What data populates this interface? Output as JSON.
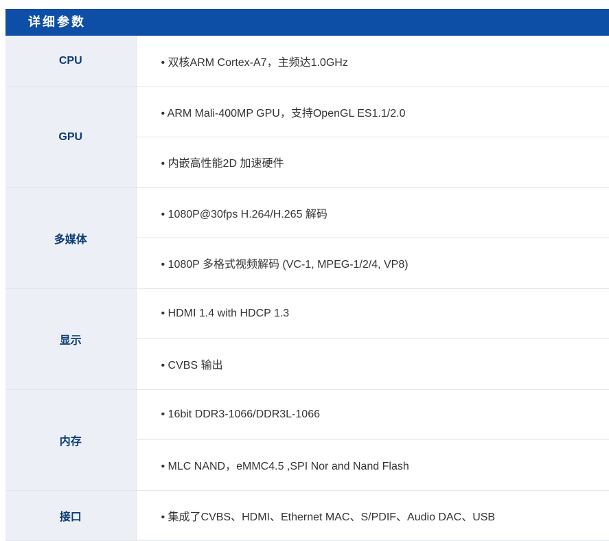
{
  "header": {
    "title": "详细参数"
  },
  "specs": [
    {
      "label": "CPU",
      "values": [
        "• 双核ARM Cortex-A7，主频达1.0GHz"
      ]
    },
    {
      "label": "GPU",
      "values": [
        "• ARM Mali-400MP GPU，支持OpenGL ES1.1/2.0",
        "• 内嵌高性能2D 加速硬件"
      ]
    },
    {
      "label": "多媒体",
      "values": [
        "• 1080P@30fps H.264/H.265 解码",
        "• 1080P 多格式视频解码 (VC-1, MPEG-1/2/4, VP8)"
      ]
    },
    {
      "label": "显示",
      "values": [
        "• HDMI 1.4 with HDCP 1.3",
        "• CVBS 输出"
      ]
    },
    {
      "label": "内存",
      "values": [
        "• 16bit DDR3-1066/DDR3L-1066",
        "• MLC NAND，eMMC4.5 ,SPI Nor and Nand Flash"
      ]
    },
    {
      "label": "接口",
      "values": [
        "• 集成了CVBS、HDMI、Ethernet MAC、S/PDIF、Audio DAC、USB"
      ]
    }
  ]
}
